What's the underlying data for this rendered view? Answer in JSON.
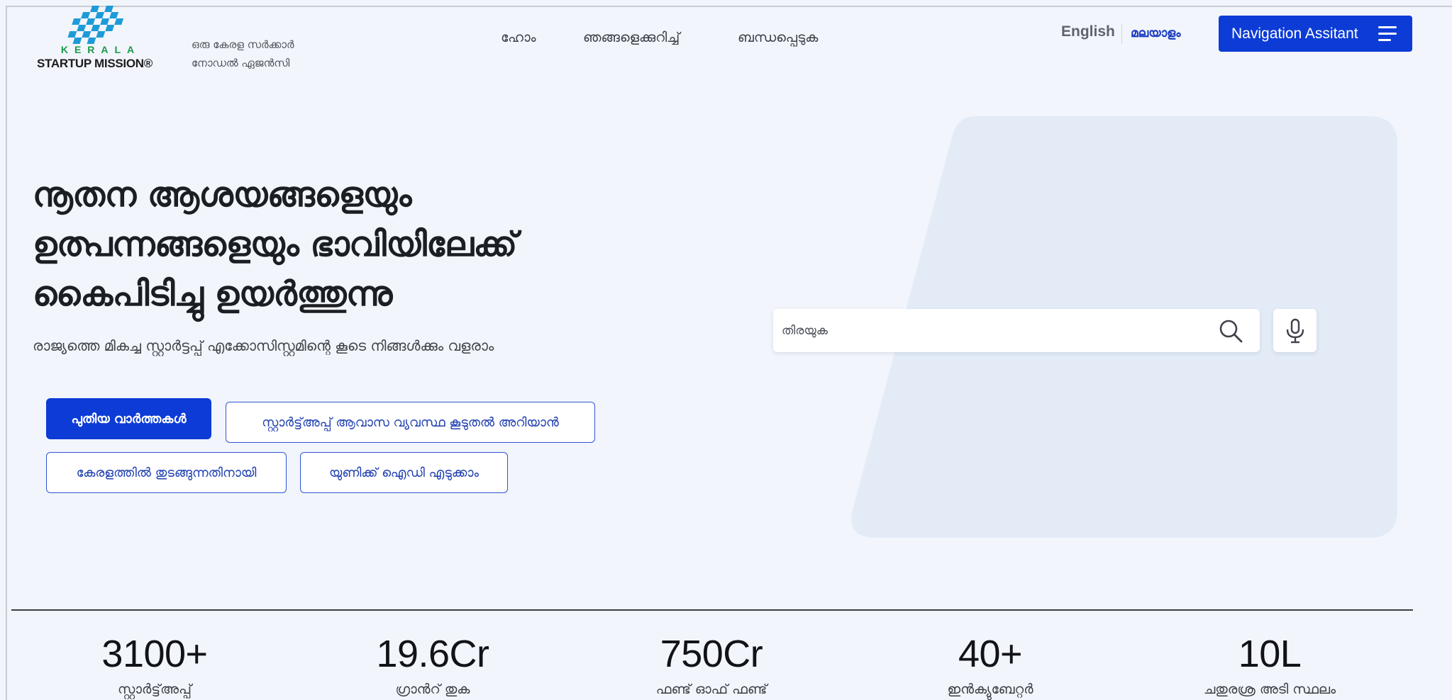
{
  "header": {
    "logo": {
      "wordmark_top": "KERALA",
      "wordmark_bottom": "STARTUP MISSION®"
    },
    "tagline_line1": "ഒരു കേരള സർക്കാർ",
    "tagline_line2": "നോഡൽ ഏജൻസി",
    "nav_items": [
      {
        "label": "ഹോം"
      },
      {
        "label": "ഞങ്ങളെക്കുറിച്ച്"
      },
      {
        "label": "ബന്ധപ്പെടുക"
      }
    ],
    "lang_english": "English",
    "lang_malayalam": "മലയാളം",
    "nav_assistant_label": "Navigation Assitant",
    "nav_assistant_icon": "hamburger-icon"
  },
  "hero": {
    "title_line1": "നൂതന ആശയങ്ങളെയും",
    "title_line2": "ഉത്പന്നങ്ങളെയും ഭാവിയിലേക്ക്",
    "title_line3": "കൈപിടിച്ചു ഉയർത്തുന്നു",
    "subtitle": "രാജ്യത്തെ മികച്ച സ്റ്റാർട്ടപ്പ് എക്കോസിസ്റ്റമിന്റെ കൂടെ നിങ്ങൾക്കും വളരാം",
    "buttons": {
      "latest_news": "പുതിയ വാർത്തകൾ",
      "learn_more": "സ്റ്റാർട്ട്അപ്പ് ആവാസ വ്യവസ്ഥ കൂടുതൽ അറിയാൻ",
      "start_in_kerala": "കേരളത്തിൽ തുടങ്ങുന്നതിനായി",
      "unique_id": "യുണിക്ക് ഐഡി എടുക്കാം"
    },
    "search": {
      "placeholder": "തിരയുക",
      "value": ""
    }
  },
  "stats": [
    {
      "value": "3100+",
      "label": "സ്റ്റാർട്ട്അപ്പ്"
    },
    {
      "value": "19.6Cr",
      "label": "ഗ്രാൻറ് തുക"
    },
    {
      "value": "750Cr",
      "label": "ഫണ്ട് ഓഫ് ഫണ്ട്"
    },
    {
      "value": "40+",
      "label": "ഇൻക്യുബേറ്റർ"
    },
    {
      "value": "10L",
      "label": "ചതുരശ്ര അടി സ്ഥലം"
    }
  ],
  "colors": {
    "primary": "#0c3bd6",
    "page_bg": "#f2f5fb",
    "hero_shape": "#e3ebf7",
    "logo_blue": "#1e9bd7",
    "logo_green": "#1a9a48"
  }
}
